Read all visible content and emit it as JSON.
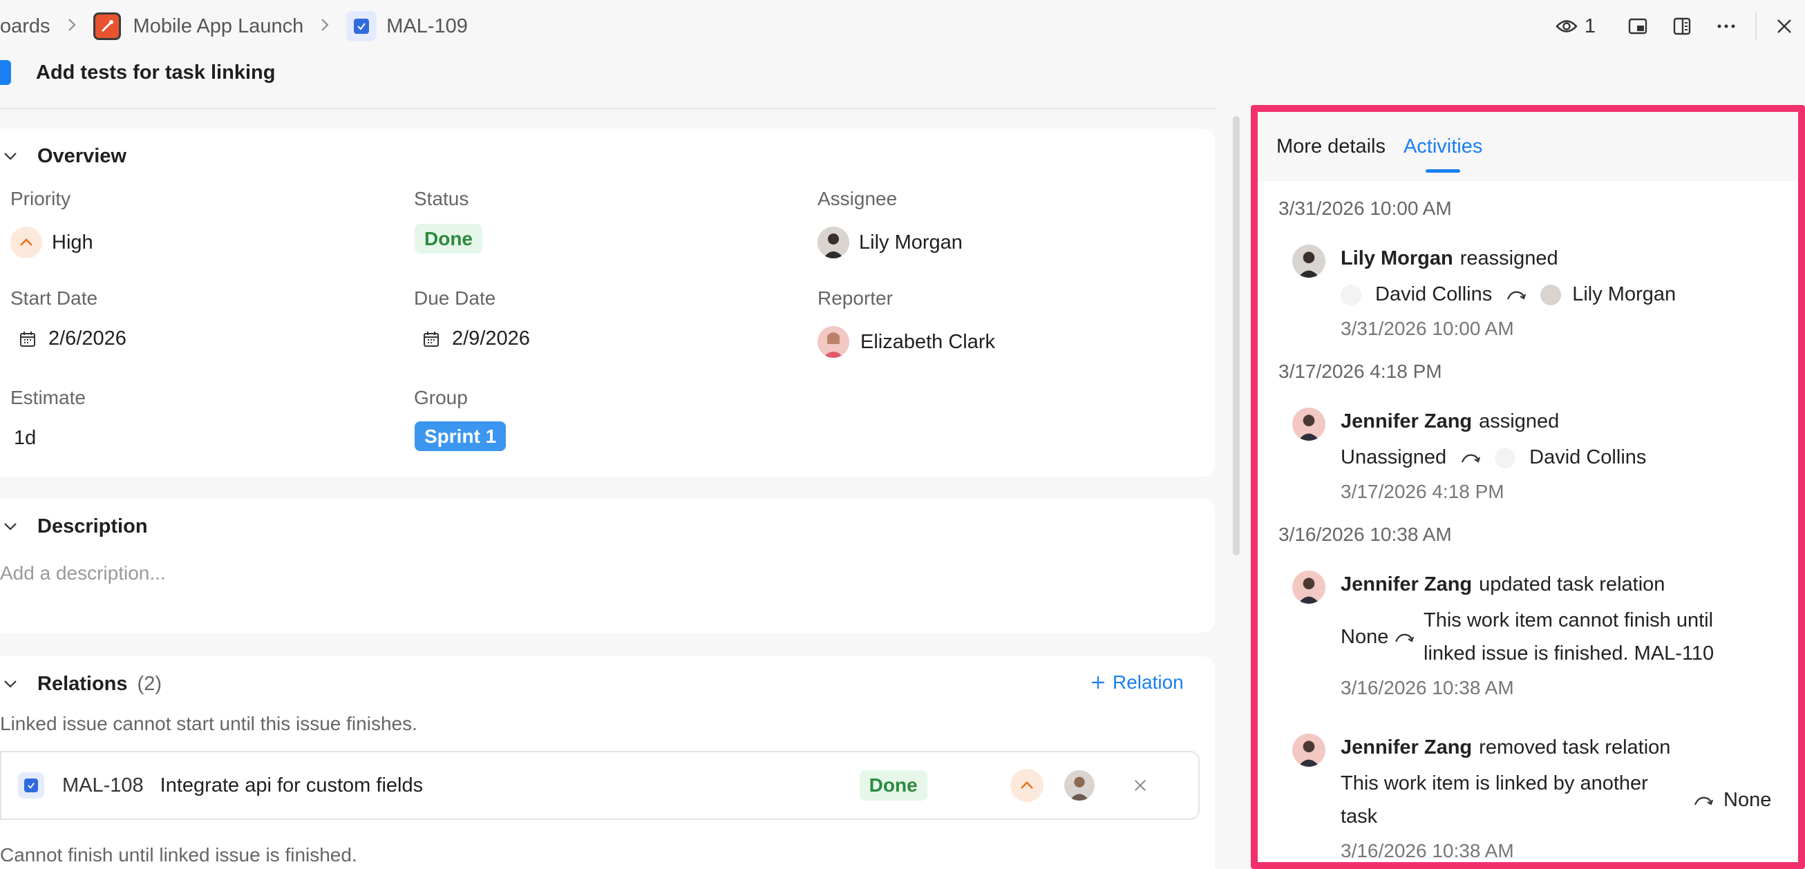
{
  "breadcrumb": {
    "boards": "oards",
    "project": "Mobile App Launch",
    "task_id": "MAL-109"
  },
  "topbar": {
    "watchers_count": "1"
  },
  "task": {
    "title": "Add tests for task linking"
  },
  "overview": {
    "heading": "Overview",
    "priority_label": "Priority",
    "priority_value": "High",
    "status_label": "Status",
    "status_value": "Done",
    "assignee_label": "Assignee",
    "assignee_value": "Lily Morgan",
    "start_label": "Start Date",
    "start_value": "2/6/2026",
    "due_label": "Due Date",
    "due_value": "2/9/2026",
    "reporter_label": "Reporter",
    "reporter_value": "Elizabeth Clark",
    "estimate_label": "Estimate",
    "estimate_value": "1d",
    "group_label": "Group",
    "group_value": "Sprint 1"
  },
  "description": {
    "heading": "Description",
    "placeholder": "Add a description..."
  },
  "relations": {
    "heading": "Relations",
    "count": "(2)",
    "add_label": "Relation",
    "group1_text": "Linked issue cannot start until this issue finishes.",
    "item1": {
      "id": "MAL-108",
      "title": "Integrate api for custom fields",
      "status": "Done"
    },
    "group2_text": "Cannot finish until linked issue is finished."
  },
  "panel": {
    "tab_details": "More details",
    "tab_activities": "Activities",
    "activities": [
      {
        "date": "3/31/2026 10:00 AM",
        "user": "Lily Morgan",
        "action": "reassigned",
        "from": "David Collins",
        "to": "Lily Morgan",
        "time": "3/31/2026 10:00 AM"
      },
      {
        "date": "3/17/2026 4:18 PM",
        "user": "Jennifer Zang",
        "action": "assigned",
        "from": "Unassigned",
        "to": "David Collins",
        "time": "3/17/2026 4:18 PM"
      },
      {
        "date": "3/16/2026 10:38 AM",
        "user": "Jennifer Zang",
        "action": "updated task relation",
        "from": "None",
        "to_line1": "This work item cannot finish until",
        "to_line2": "linked issue is finished. MAL-110",
        "time": "3/16/2026 10:38 AM"
      },
      {
        "user": "Jennifer Zang",
        "action": "removed task relation",
        "from_line1": "This work item is linked by another",
        "from_line2": "task",
        "to": "None",
        "time": "3/16/2026 10:38 AM"
      }
    ]
  },
  "colors": {
    "accent": "#1a7ff0",
    "highlight_border": "#f0316b",
    "done_green": "#2b8a3e",
    "sprint_blue": "#3b96f0"
  }
}
